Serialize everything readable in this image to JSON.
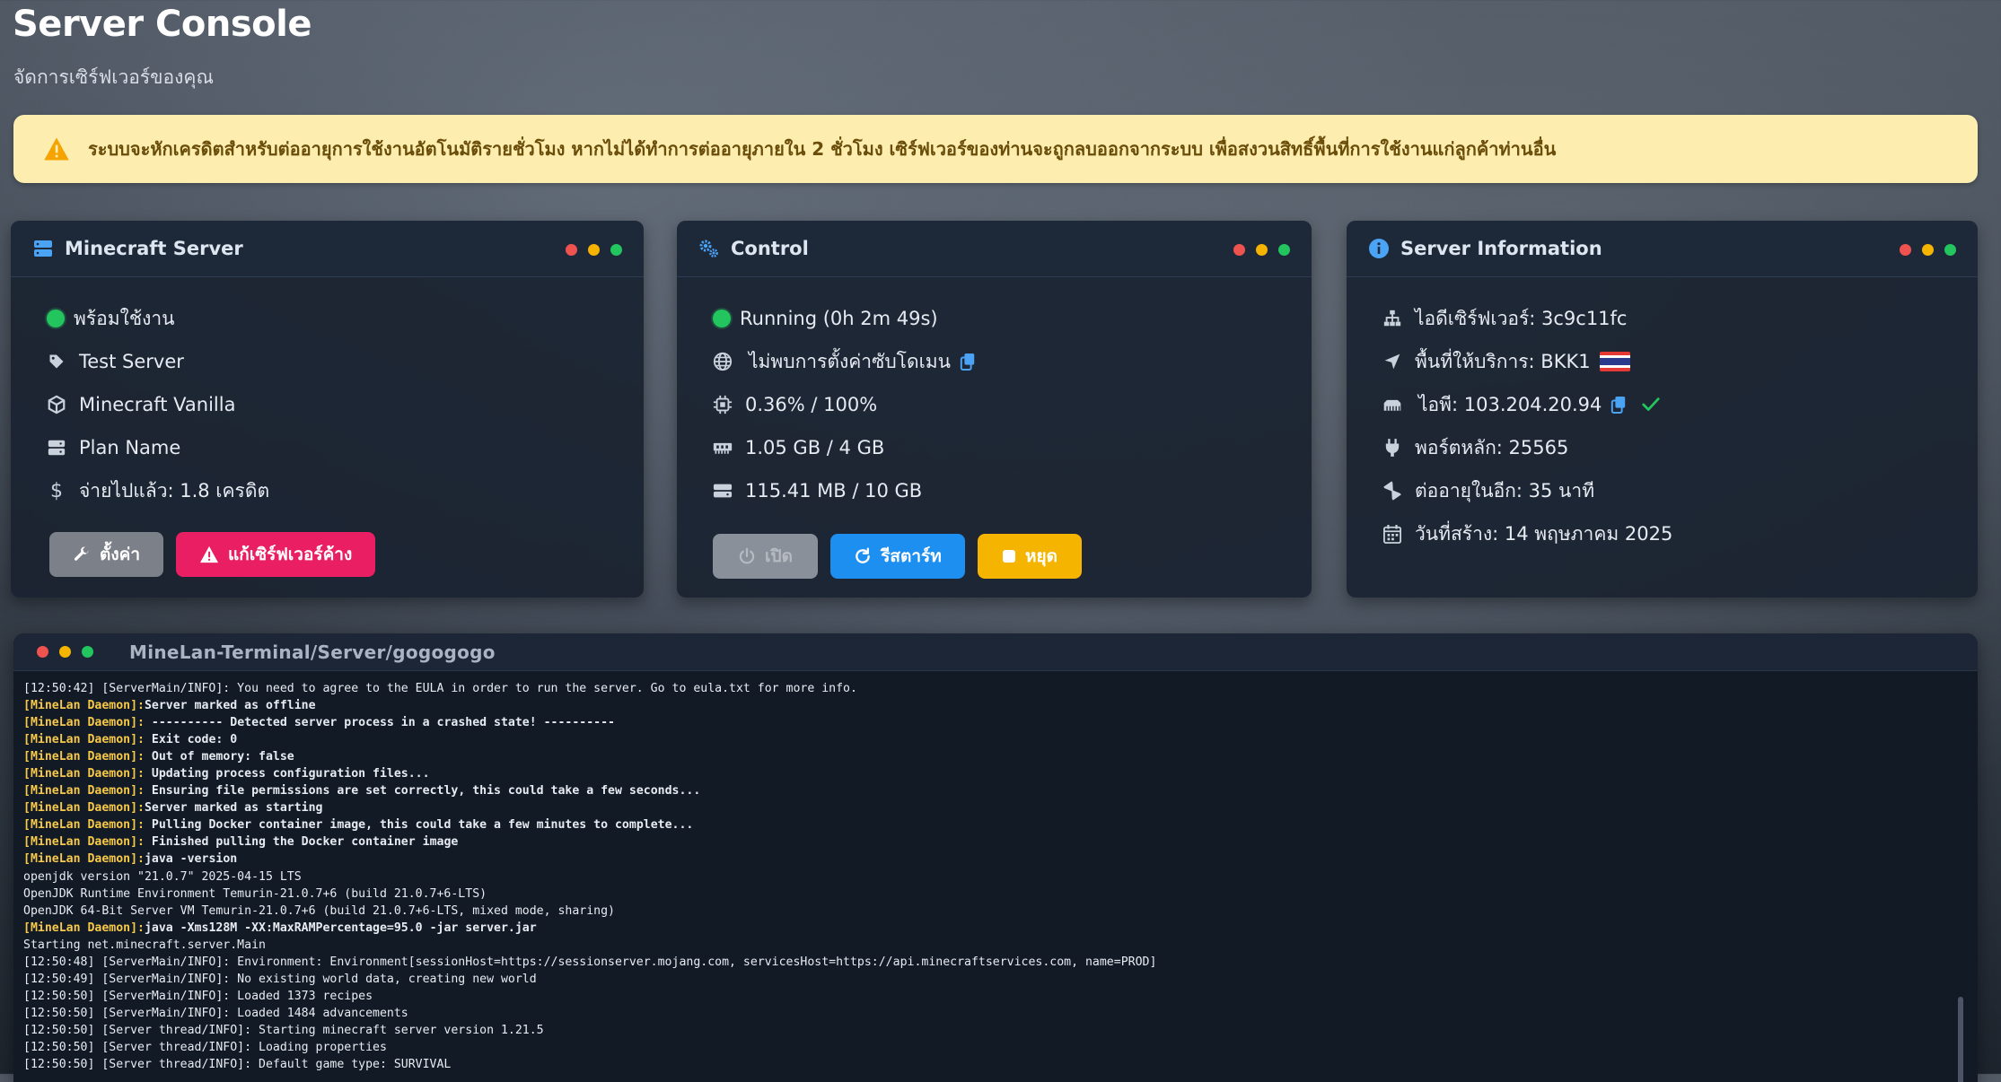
{
  "page": {
    "title": "Server Console",
    "subtitle": "จัดการเซิร์ฟเวอร์ของคุณ"
  },
  "alert": {
    "text": "ระบบจะหักเครดิตสำหรับต่ออายุการใช้งานอัตโนมัติรายชั่วโมง หากไม่ได้ทำการต่ออายุภายใน 2 ชั่วโมง เซิร์ฟเวอร์ของท่านจะถูกลบออกจากระบบ เพื่อสงวนสิทธิ์พื้นที่การใช้งานแก่ลูกค้าท่านอื่น",
    "icon": "warning-icon",
    "color": "#fdeeb0"
  },
  "minecraft_card": {
    "title": "Minecraft Server",
    "status": "พร้อมใช้งาน",
    "name": "Test Server",
    "type": "Minecraft Vanilla",
    "plan": "Plan Name",
    "paid": "จ่ายไปแล้ว: 1.8 เครดิต",
    "settings_label": "ตั้งค่า",
    "fix_label": "แก้เซิร์ฟเวอร์ค้าง"
  },
  "control_card": {
    "title": "Control",
    "status": "Running (0h 2m 49s)",
    "subdomain": "ไม่พบการตั้งค่าซับโดเมน",
    "cpu": "0.36% / 100%",
    "memory": "1.05 GB / 4 GB",
    "disk": "115.41 MB / 10 GB",
    "start_label": "เปิด",
    "restart_label": "รีสตาร์ท",
    "stop_label": "หยุด"
  },
  "info_card": {
    "title": "Server Information",
    "server_id": "ไอดีเซิร์ฟเวอร์: 3c9c11fc",
    "region": "พื้นที่ให้บริการ: BKK1",
    "ip": "ไอพี: 103.204.20.94",
    "port": "พอร์ตหลัก: 25565",
    "renew": "ต่ออายุในอีก: 35 นาที",
    "created": "วันที่สร้าง: 14 พฤษภาคม 2025"
  },
  "terminal": {
    "title": "MineLan-Terminal/Server/gogogogo",
    "lines": [
      {
        "prefix": "",
        "text": "[12:50:42] [ServerMain/INFO]: You need to agree to the EULA in order to run the server. Go to eula.txt for more info."
      },
      {
        "prefix": "[MineLan Daemon]:",
        "text": "Server marked as offline"
      },
      {
        "prefix": "[MineLan Daemon]:",
        "text": " ---------- Detected server process in a crashed state! ----------"
      },
      {
        "prefix": "[MineLan Daemon]:",
        "text": " Exit code: 0"
      },
      {
        "prefix": "[MineLan Daemon]:",
        "text": " Out of memory: false"
      },
      {
        "prefix": "[MineLan Daemon]:",
        "text": " Updating process configuration files..."
      },
      {
        "prefix": "[MineLan Daemon]:",
        "text": " Ensuring file permissions are set correctly, this could take a few seconds..."
      },
      {
        "prefix": "[MineLan Daemon]:",
        "text": "Server marked as starting"
      },
      {
        "prefix": "[MineLan Daemon]:",
        "text": " Pulling Docker container image, this could take a few minutes to complete..."
      },
      {
        "prefix": "[MineLan Daemon]:",
        "text": " Finished pulling the Docker container image"
      },
      {
        "prefix": "[MineLan Daemon]:",
        "text": "java -version"
      },
      {
        "prefix": "",
        "text": "openjdk version \"21.0.7\" 2025-04-15 LTS"
      },
      {
        "prefix": "",
        "text": "OpenJDK Runtime Environment Temurin-21.0.7+6 (build 21.0.7+6-LTS)"
      },
      {
        "prefix": "",
        "text": "OpenJDK 64-Bit Server VM Temurin-21.0.7+6 (build 21.0.7+6-LTS, mixed mode, sharing)"
      },
      {
        "prefix": "[MineLan Daemon]:",
        "text": "java -Xms128M -XX:MaxRAMPercentage=95.0 -jar server.jar"
      },
      {
        "prefix": "",
        "text": "Starting net.minecraft.server.Main"
      },
      {
        "prefix": "",
        "text": "[12:50:48] [ServerMain/INFO]: Environment: Environment[sessionHost=https://sessionserver.mojang.com, servicesHost=https://api.minecraftservices.com, name=PROD]"
      },
      {
        "prefix": "",
        "text": "[12:50:49] [ServerMain/INFO]: No existing world data, creating new world"
      },
      {
        "prefix": "",
        "text": "[12:50:50] [ServerMain/INFO]: Loaded 1373 recipes"
      },
      {
        "prefix": "",
        "text": "[12:50:50] [ServerMain/INFO]: Loaded 1484 advancements"
      },
      {
        "prefix": "",
        "text": "[12:50:50] [Server thread/INFO]: Starting minecraft server version 1.21.5"
      },
      {
        "prefix": "",
        "text": "[12:50:50] [Server thread/INFO]: Loading properties"
      },
      {
        "prefix": "",
        "text": "[12:50:50] [Server thread/INFO]: Default game type: SURVIVAL"
      }
    ]
  },
  "colors": {
    "card_bg": "#1a2230",
    "status_green": "#22c55e",
    "accent_blue": "#1d8ff0",
    "accent_pink": "#e91e63",
    "accent_yellow": "#f5b400",
    "daemon_prefix": "#f7c948"
  }
}
